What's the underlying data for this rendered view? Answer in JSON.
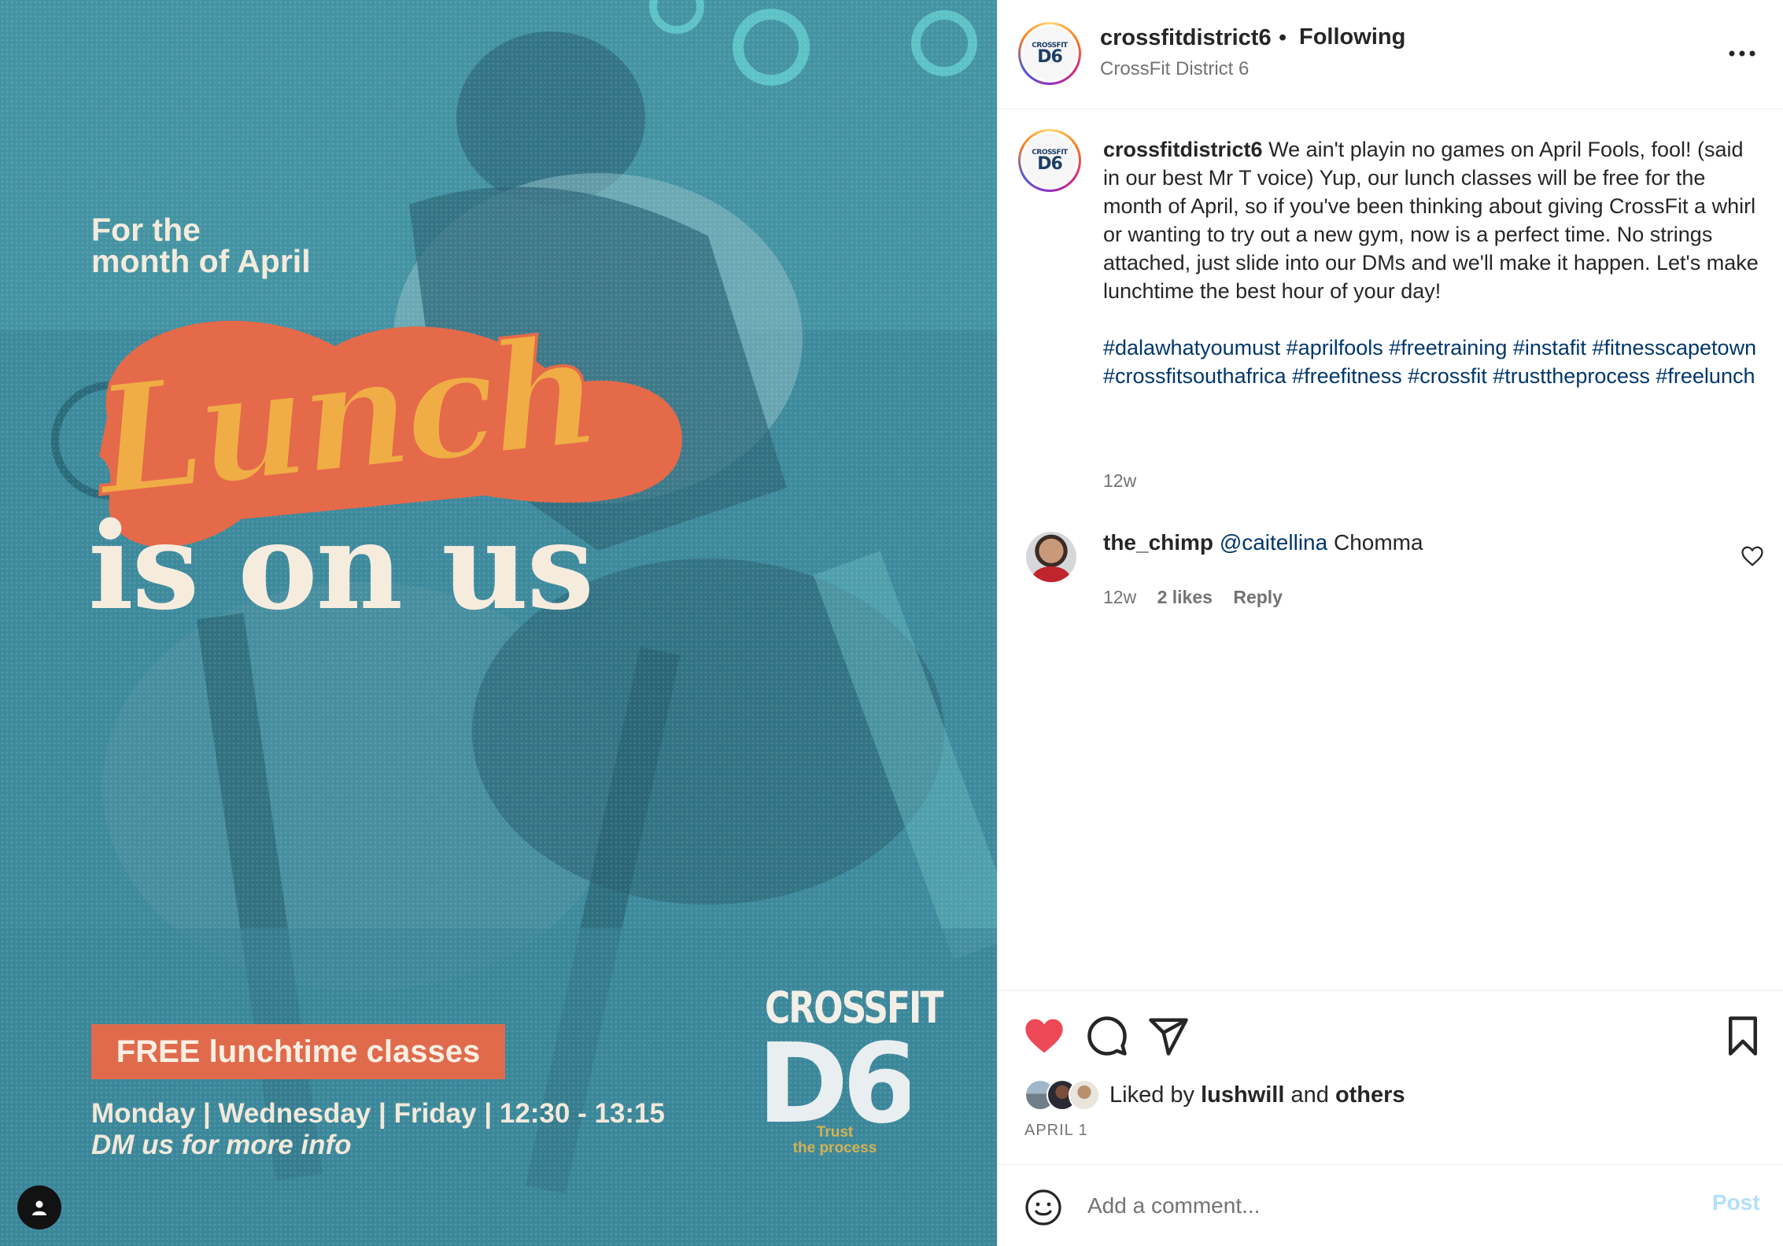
{
  "post_image": {
    "line_small_1": "For the",
    "line_small_2": "month of April",
    "script_word": "Lunch",
    "headline": "is on us",
    "badge": "FREE lunchtime classes",
    "schedule": "Monday | Wednesday | Friday | 12:30 - 13:15",
    "dm_line": "DM us for more info",
    "brand_word": "CROSSFIT",
    "brand_mark": "D6",
    "brand_tagline_1": "Trust",
    "brand_tagline_2": "the process",
    "colors": {
      "background": "#3f8ea0",
      "accent_orange": "#e06b4c",
      "accent_yellow": "#f0ad45",
      "cream": "#f6ecde"
    }
  },
  "header": {
    "username": "crossfitdistrict6",
    "separator": "•",
    "follow_status": "Following",
    "subtitle": "CrossFit District 6",
    "avatar_small": "CROSSFIT",
    "avatar_big": "D6"
  },
  "caption": {
    "username": "crossfitdistrict6",
    "text": "We ain't playin no games on April Fools, fool! (said in our best Mr T voice) Yup, our lunch classes will be free for the month of April, so if you've been thinking about giving CrossFit a whirl or wanting to try out a new gym, now is a perfect time. No strings attached, just slide into our DMs and we'll make it happen. Let's make lunchtime the best hour of your day!",
    "hashtags": [
      "#dalawhatyoumust",
      "#aprilfools",
      "#freetraining",
      "#instafit",
      "#fitnesscapetown",
      "#crossfitsouthafrica",
      "#freefitness",
      "#crossfit",
      "#trusttheprocess",
      "#freelunch"
    ],
    "time": "12w"
  },
  "comment": {
    "username": "the_chimp",
    "mention": "@caitellina",
    "text": "Chomma",
    "time": "12w",
    "likes": "2 likes",
    "reply": "Reply"
  },
  "actions": {
    "liked_by_prefix": "Liked by",
    "liked_by_user": "lushwill",
    "liked_by_and": "and",
    "liked_by_others": "others",
    "date": "APRIL 1",
    "like_color": "#ed4956"
  },
  "comment_box": {
    "placeholder": "Add a comment...",
    "post_label": "Post"
  }
}
